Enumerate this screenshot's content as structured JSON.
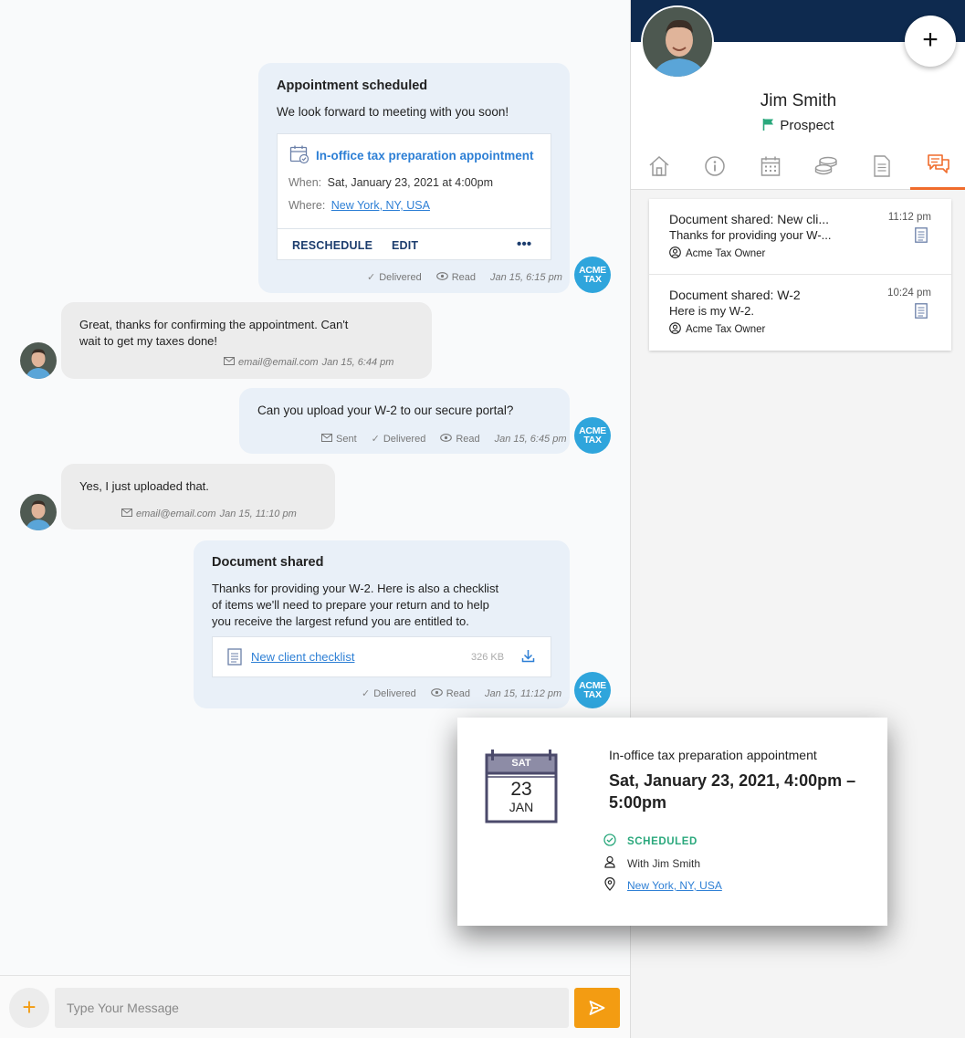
{
  "chat": {
    "messages": [
      {
        "title": "Appointment scheduled",
        "text": "We look forward to meeting with you soon!",
        "appointment": {
          "name": "In-office tax preparation appointment",
          "when_label": "When:",
          "when_value": "Sat, January 23, 2021 at 4:00pm",
          "where_label": "Where:",
          "where_value": "New York, NY, USA",
          "actions": {
            "reschedule": "RESCHEDULE",
            "edit": "EDIT",
            "more": "•••"
          }
        },
        "meta": {
          "delivered": "Delivered",
          "read": "Read",
          "time": "Jan 15, 6:15 pm"
        },
        "avatar": "ACME TAX"
      },
      {
        "text_line1": "Great, thanks for confirming the appointment. Can't",
        "text_line2": "wait to get my taxes done!",
        "meta": {
          "email": "email@email.com",
          "time": "Jan 15, 6:44 pm"
        }
      },
      {
        "text": "Can you upload your W-2 to our secure portal?",
        "meta": {
          "sent": "Sent",
          "delivered": "Delivered",
          "read": "Read",
          "time": "Jan 15, 6:45 pm"
        },
        "avatar": "ACME TAX"
      },
      {
        "text": "Yes, I just uploaded that.",
        "meta": {
          "email": "email@email.com",
          "time": "Jan 15, 11:10 pm"
        }
      },
      {
        "title": "Document shared",
        "text_line1": "Thanks for providing your W-2. Here is also a checklist",
        "text_line2": "of items we'll need to prepare your return and to help",
        "text_line3": "you receive the largest refund you are entitled to.",
        "document": {
          "name": "New client checklist",
          "size": "326 KB"
        },
        "meta": {
          "delivered": "Delivered",
          "read": "Read",
          "time": "Jan 15, 11:12 pm"
        },
        "avatar": "ACME TAX"
      }
    ],
    "composer": {
      "placeholder": "Type Your Message",
      "add_icon": "+"
    }
  },
  "panel": {
    "fab_icon": "+",
    "contact_name": "Jim Smith",
    "contact_status": "Prospect",
    "tabs": [
      "home-icon",
      "info-icon",
      "calendar-icon",
      "coins-icon",
      "document-icon",
      "chat-icon"
    ],
    "active_tab": "chat-icon",
    "conversations": [
      {
        "title": "Document shared: New cli...",
        "preview": "Thanks for providing your W-...",
        "owner": "Acme Tax Owner",
        "time": "11:12 pm"
      },
      {
        "title": "Document shared: W-2",
        "preview": "Here is my W-2.",
        "owner": "Acme Tax Owner",
        "time": "10:24 pm"
      }
    ]
  },
  "popup": {
    "calendar": {
      "weekday": "SAT",
      "day": "23",
      "month": "JAN"
    },
    "title": "In-office tax preparation appointment",
    "when": "Sat, January 23, 2021, 4:00pm – 5:00pm",
    "status": "SCHEDULED",
    "with": "With Jim Smith",
    "location": "New York, NY, USA"
  },
  "colors": {
    "accent": "#f39c12",
    "navy": "#0e2a4f",
    "acme": "#2fa5dc",
    "tab_active": "#f06c2c",
    "status_green": "#2aa87c"
  }
}
